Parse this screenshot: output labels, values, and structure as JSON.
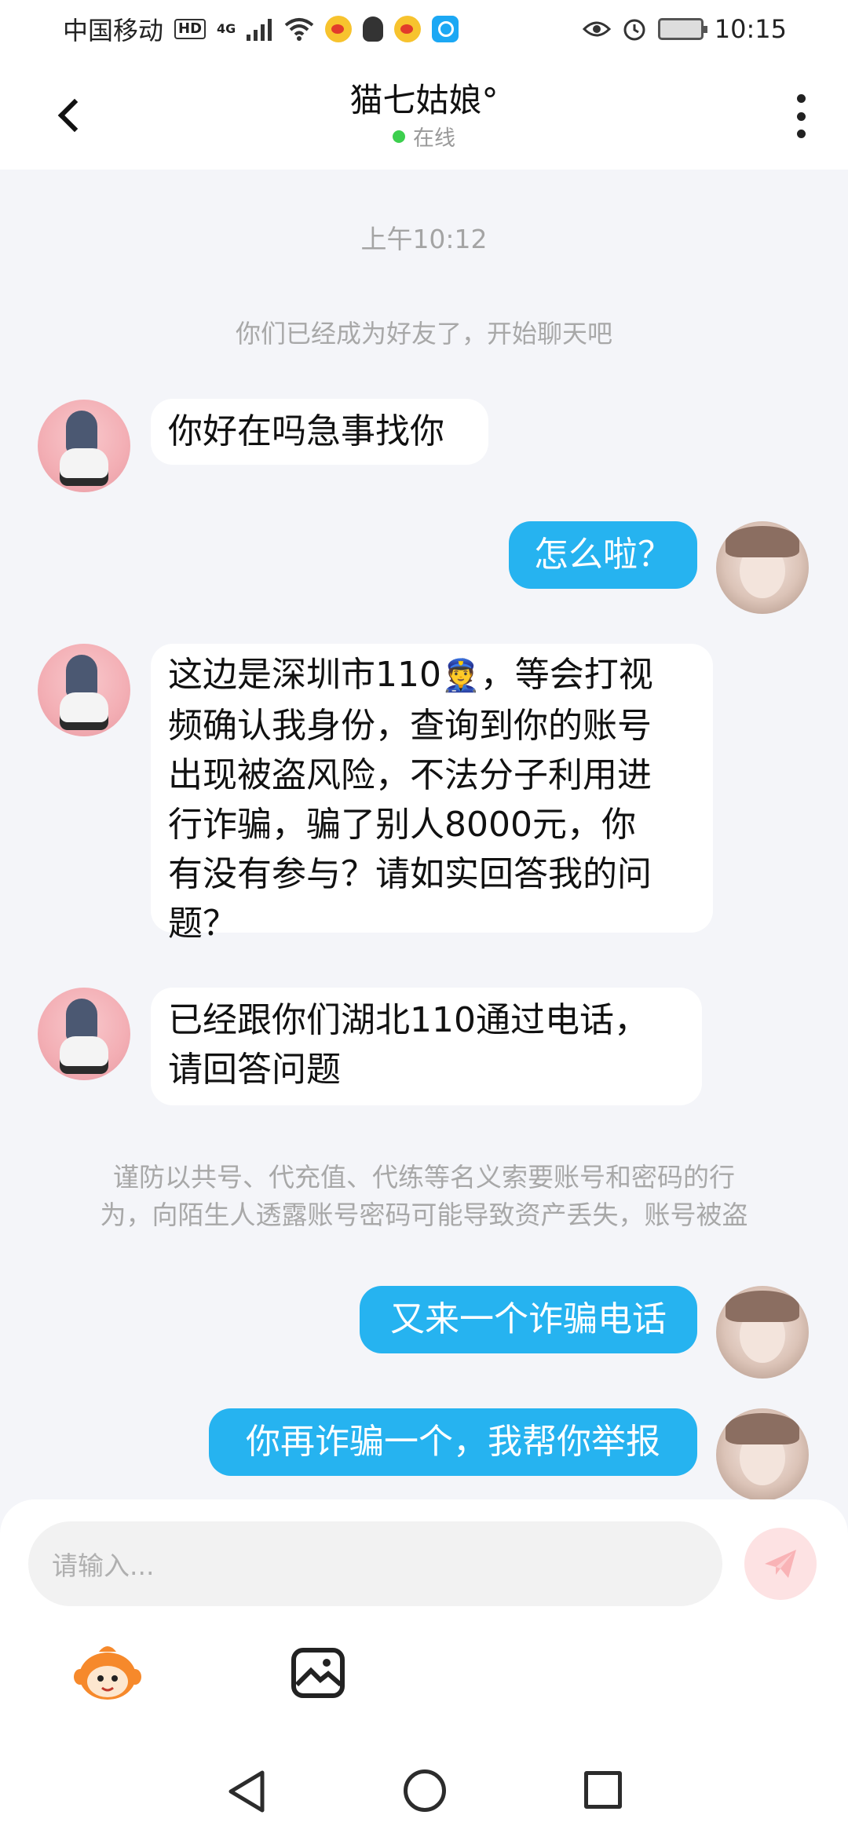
{
  "status_bar": {
    "carrier": "中国移动",
    "hd": "HD",
    "network": "4G",
    "time": "10:15"
  },
  "header": {
    "title": "猫七姑娘°",
    "status": "在线"
  },
  "chat": {
    "timestamp": "上午10:12",
    "system_message": "你们已经成为好友了，开始聊天吧",
    "messages": [
      {
        "side": "left",
        "text": "你好在吗急事找你"
      },
      {
        "side": "right",
        "text": "怎么啦？"
      },
      {
        "side": "left",
        "lines": [
          "这边是深圳市110",
          "，等会打视",
          "频确认我身份，查询到你的账号",
          "出现被盗风险，不法分子利用进",
          "行诈骗，骗了别人8000元，你",
          "有没有参与？请如实回答我的问",
          "题？"
        ],
        "emoji": "👮"
      },
      {
        "side": "left",
        "lines": [
          "已经跟你们湖北110通过电话，",
          "请回答问题"
        ]
      },
      {
        "side": "right",
        "text": "又来一个诈骗电话"
      },
      {
        "side": "right",
        "text": "你再诈骗一个，我帮你举报"
      }
    ],
    "warning_lines": [
      "谨防以共号、代充值、代练等名义索要账号和密码的行",
      "为，向陌生人透露账号密码可能导致资产丢失，账号被盗"
    ]
  },
  "input": {
    "placeholder": "请输入..."
  },
  "colors": {
    "bubble_right": "#26b3f0",
    "online_dot": "#3ccf4e",
    "send_button": "#fde2e3"
  }
}
